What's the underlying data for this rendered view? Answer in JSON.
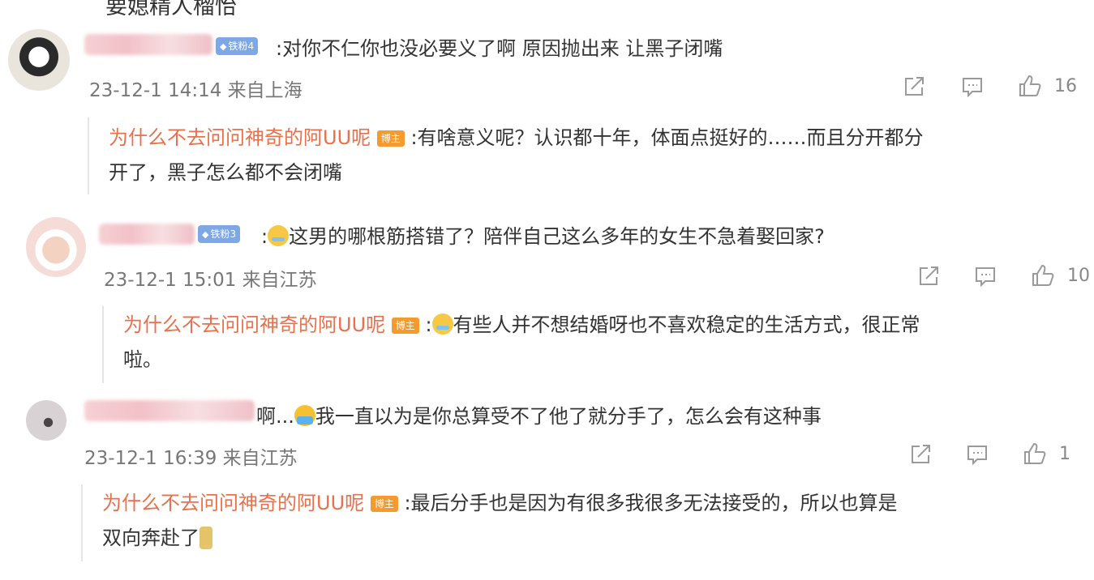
{
  "top_fragment": "要媳精人榴怡",
  "comments": [
    {
      "fan_badge": "铁粉4",
      "text": ":对你不仁你也没必要义了啊 原因抛出来 让黑子闭嘴",
      "meta": "23-12-1 14:14 来自上海",
      "likes": "16",
      "reply": {
        "author": "为什么不去问问神奇的阿UU呢",
        "host_badge": "博主",
        "text_line1": ":有啥意义呢？认识都十年，体面点挺好的……而且分开都分",
        "text_line2": "开了，黑子怎么都不会闭嘴"
      }
    },
    {
      "fan_badge": "铁粉3",
      "text_prefix": ":",
      "emoji": "cry-laugh-emoji",
      "text": "这男的哪根筋搭错了？陪伴自己这么多年的女生不急着娶回家?",
      "meta": "23-12-1 15:01 来自江苏",
      "likes": "10",
      "reply": {
        "author": "为什么不去问问神奇的阿UU呢",
        "host_badge": "博主",
        "text_prefix": ":",
        "emoji": "cry-laugh-emoji",
        "text_line1": "有些人并不想结婚呀也不喜欢稳定的生活方式，很正常",
        "text_line2": "啦。"
      }
    },
    {
      "text_prefix": "啊...",
      "emoji": "sob-emoji",
      "text": "我一直以为是你总算受不了他了就分手了，怎么会有这种事",
      "meta": "23-12-1 16:39 来自江苏",
      "likes": "1",
      "reply": {
        "author": "为什么不去问问神奇的阿UU呢",
        "host_badge": "博主",
        "text_line1": ":最后分手也是因为有很多我很多无法接受的，所以也算是",
        "text_line2": "双向奔赴了",
        "emoji": "person-emoji"
      }
    }
  ],
  "colors": {
    "reply_author": "#e8704a",
    "host_badge": "#f59a2c",
    "fan_badge": "#7ea7e6",
    "meta_text": "#777777",
    "icon": "#9a9a9a"
  },
  "icons": [
    "share-icon",
    "comment-icon",
    "like-icon"
  ]
}
